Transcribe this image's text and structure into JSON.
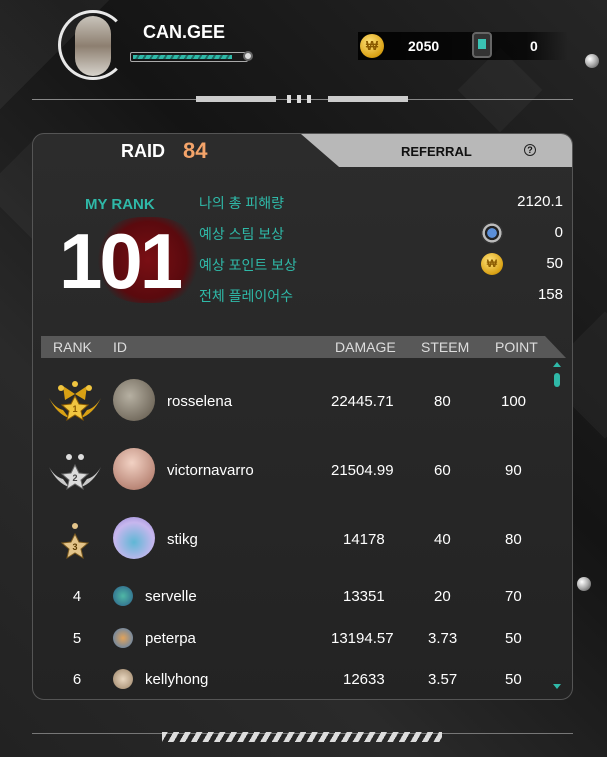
{
  "header": {
    "username": "CAN.GEE",
    "xp_progress_pct": 88,
    "coins": "2050",
    "tickets": "0",
    "coin_icon_glyph": "₩"
  },
  "raid": {
    "tab_label": "RAID",
    "value": "84",
    "referral_label": "REFERRAL",
    "help_glyph": "?"
  },
  "my_rank": {
    "label": "MY RANK",
    "value": "101",
    "stats": [
      {
        "label": "나의 총 피해량",
        "value": "2120.1",
        "icon": ""
      },
      {
        "label": "예상 스팀 보상",
        "value": "0",
        "icon": "steem-icon"
      },
      {
        "label": "예상 포인트 보상",
        "value": "50",
        "icon": "point-icon"
      },
      {
        "label": "전체 플레이어수",
        "value": "158",
        "icon": ""
      }
    ]
  },
  "table": {
    "headers": {
      "rank": "RANK",
      "id": "ID",
      "damage": "DAMAGE",
      "steem": "STEEM",
      "point": "POINT"
    },
    "rows": [
      {
        "rank": "1",
        "id": "rosselena",
        "damage": "22445.71",
        "steem": "80",
        "point": "100"
      },
      {
        "rank": "2",
        "id": "victornavarro",
        "damage": "21504.99",
        "steem": "60",
        "point": "90"
      },
      {
        "rank": "3",
        "id": "stikg",
        "damage": "14178",
        "steem": "40",
        "point": "80"
      },
      {
        "rank": "4",
        "id": "servelle",
        "damage": "13351",
        "steem": "20",
        "point": "70"
      },
      {
        "rank": "5",
        "id": "peterpa",
        "damage": "13194.57",
        "steem": "3.73",
        "point": "50"
      },
      {
        "rank": "6",
        "id": "kellyhong",
        "damage": "12633",
        "steem": "3.57",
        "point": "50"
      }
    ]
  },
  "colors": {
    "accent_teal": "#2fb9a8",
    "raid_orange": "#f4a46a",
    "gold": "#d9a114"
  }
}
